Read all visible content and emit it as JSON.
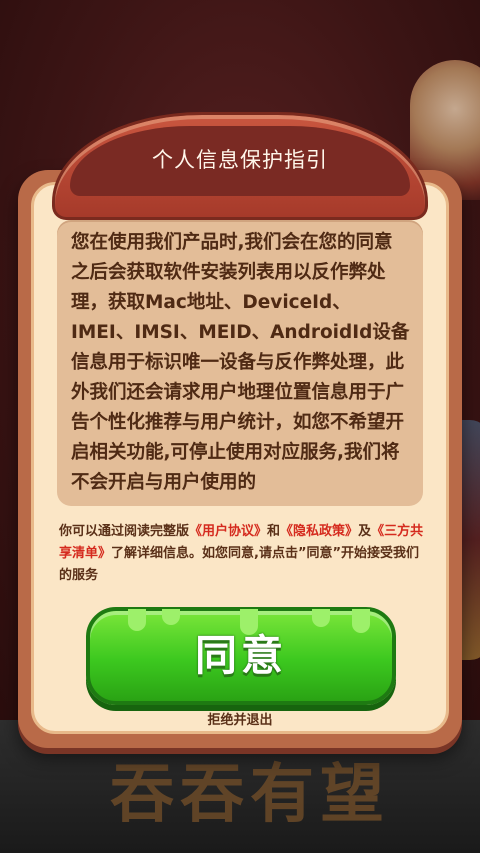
{
  "dialog": {
    "title": "个人信息保护指引",
    "body_text": "您在使用我们产品时,我们会在您的同意之后会获取软件安装列表用以反作弊处理，获取Mac地址、DeviceId、IMEI、IMSI、MEID、AndroidId设备信息用于标识唯一设备与反作弊处理，此外我们还会请求用户地理位置信息用于广告个性化推荐与用户统计，如您不希望开启相关功能,可停止使用对应服务,我们将不会开启与用户使用的",
    "notice": {
      "prefix": "你可以通过阅读完整版",
      "link_user_agreement": "《用户协议》",
      "and": "和",
      "link_privacy": "《隐私政策》",
      "and2": "及",
      "link_third_party": "《三方共享清单》",
      "suffix": "了解详细信息。如您同意,请点击”同意”开始接受我们的服务"
    },
    "agree_label": "同意",
    "reject_label": "拒绝并退出"
  },
  "background": {
    "bottom_text": "吞吞有望"
  },
  "colors": {
    "accent_link": "#d52a1e",
    "agree_green": "#3cc81f",
    "frame": "#b96a48"
  }
}
